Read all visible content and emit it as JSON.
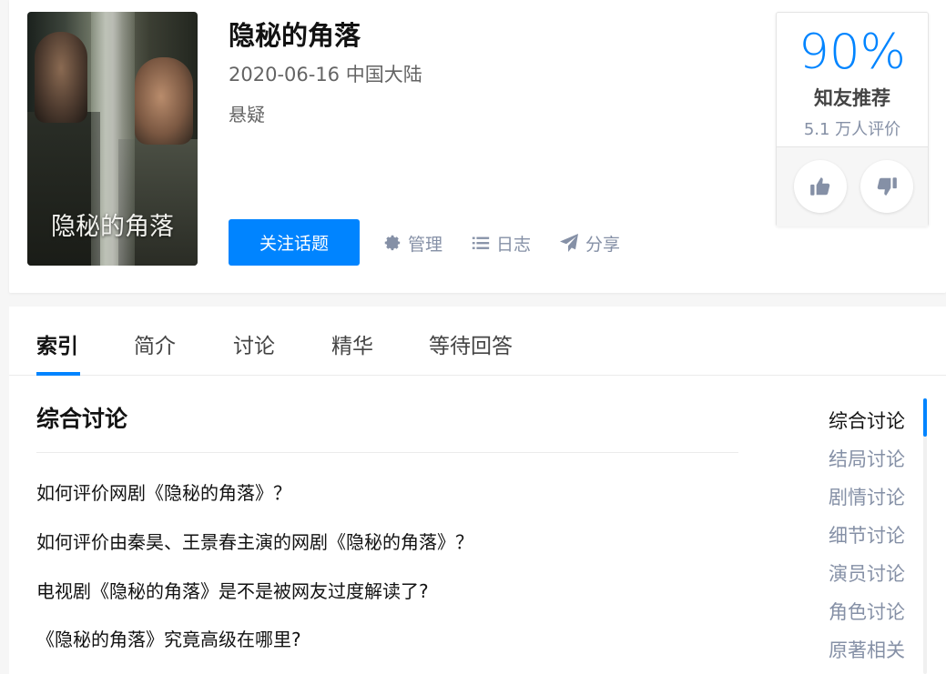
{
  "topic": {
    "title": "隐秘的角落",
    "meta": "2020-06-16 中国大陆",
    "genre": "悬疑",
    "poster_text": "隐秘的角落",
    "follow_label": "关注话题",
    "actions": [
      {
        "label": "管理",
        "icon": "gear-icon"
      },
      {
        "label": "日志",
        "icon": "list-icon"
      },
      {
        "label": "分享",
        "icon": "paper-plane-icon"
      }
    ]
  },
  "rating": {
    "percent": "90%",
    "label": "知友推荐",
    "count": "5.1 万人评价",
    "upvote_icon": "thumbs-up-icon",
    "downvote_icon": "thumbs-down-icon"
  },
  "tabs": [
    {
      "label": "索引",
      "active": true
    },
    {
      "label": "简介"
    },
    {
      "label": "讨论"
    },
    {
      "label": "精华"
    },
    {
      "label": "等待回答"
    }
  ],
  "section": {
    "title": "综合讨论",
    "questions": [
      "如何评价网剧《隐秘的角落》？",
      "如何评价由秦昊、王景春主演的网剧《隐秘的角落》？",
      "电视剧《隐秘的角落》是不是被网友过度解读了?",
      "《隐秘的角落》究竟高级在哪里?"
    ]
  },
  "side_nav": [
    "综合讨论",
    "结局讨论",
    "剧情讨论",
    "细节讨论",
    "演员讨论",
    "角色讨论",
    "原著相关"
  ],
  "colors": {
    "accent": "#0084ff",
    "muted": "#8590a6"
  }
}
